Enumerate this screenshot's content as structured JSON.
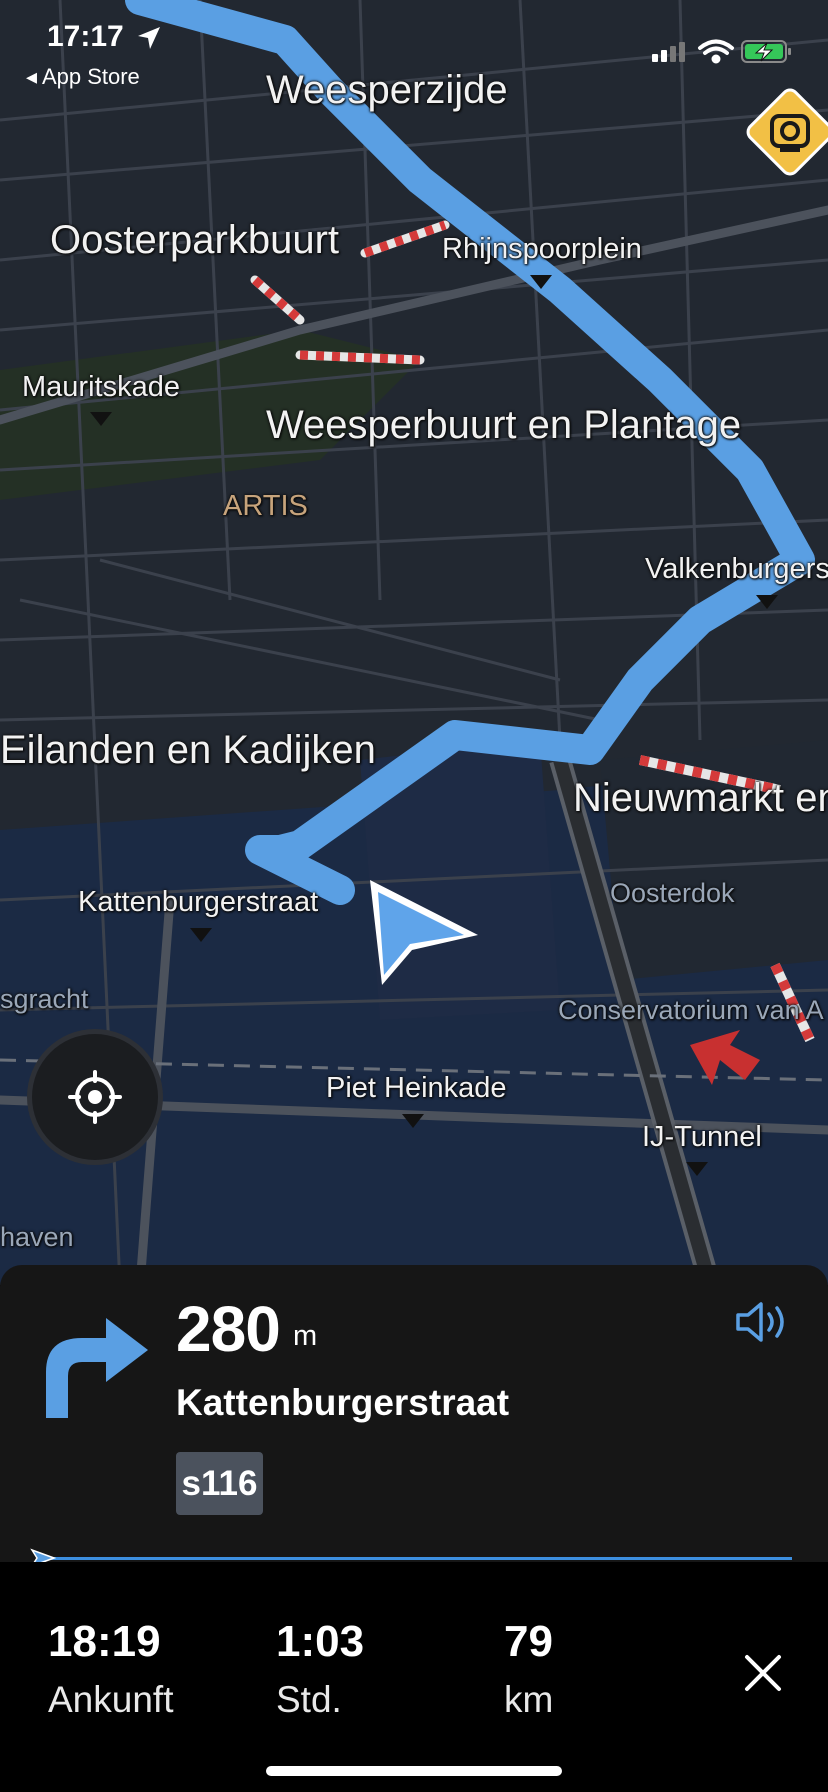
{
  "status_bar": {
    "time": "17:17",
    "back_app": "◂ App Store"
  },
  "map": {
    "labels": {
      "weesperzijde": "Weesperzijde",
      "oosterparkbuurt": "Oosterparkbuurt",
      "rhijnspoorplein": "Rhijnspoorplein",
      "mauritskade": "Mauritskade",
      "weesperbuurt": "Weesperbuurt en Plantage",
      "artis": "ARTIS",
      "valkenburgers": "Valkenburgers",
      "eilanden": "Eilanden en Kadijken",
      "nieuwmarkt": "Nieuwmarkt en",
      "oosterdok": "Oosterdok",
      "kattenburgerstraat": "Kattenburgerstraat",
      "gracht": "sgracht",
      "conservatorium": "Conservatorium van A",
      "piet_heinkade": "Piet Heinkade",
      "ij_tunnel": "IJ-Tunnel",
      "haven": "haven"
    },
    "route_color": "#5a9fe3",
    "camera_badge_color": "#f2c045"
  },
  "guidance": {
    "distance_value": "280",
    "distance_unit": "m",
    "street": "Kattenburgerstraat",
    "road_number": "s116",
    "turn_direction": "right"
  },
  "trip": {
    "progress": 0.0,
    "arrival_value": "18:19",
    "arrival_label": "Ankunft",
    "duration_value": "1:03",
    "duration_label": "Std.",
    "distance_value": "79",
    "distance_label": "km"
  },
  "icons": {
    "turn": "turn-right-icon",
    "sound": "speaker-icon",
    "close": "close-icon",
    "locate": "crosshair-icon",
    "camera": "speed-camera-icon"
  }
}
